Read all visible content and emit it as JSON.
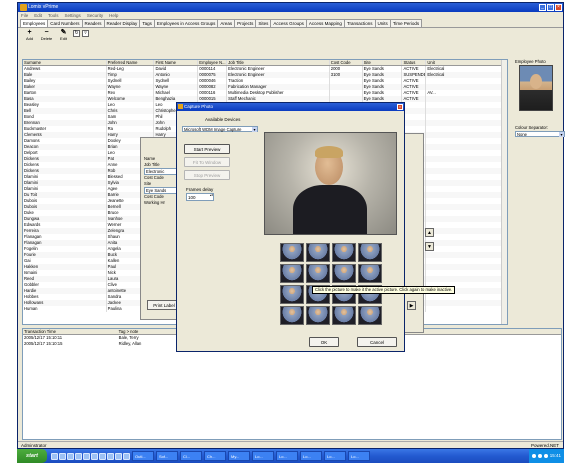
{
  "window": {
    "title": "Lomix vPrime"
  },
  "menu": [
    "File",
    "Edit",
    "Tools",
    "Settings",
    "Security",
    "Help"
  ],
  "tabs": [
    {
      "label": "Employees",
      "active": true
    },
    {
      "label": "Card Numbers"
    },
    {
      "label": "Readers"
    },
    {
      "label": "Reader Display"
    },
    {
      "label": "Tags"
    },
    {
      "label": "Employees in Access Groups"
    },
    {
      "label": "Areas"
    },
    {
      "label": "Projects"
    },
    {
      "label": "Sites"
    },
    {
      "label": "Access Groups"
    },
    {
      "label": "Access Mapping"
    },
    {
      "label": "Transactions"
    },
    {
      "label": "Units"
    },
    {
      "label": "Time Periods"
    }
  ],
  "toolbar": {
    "add": "Add",
    "delete": "Delete",
    "edit": "Edit"
  },
  "employees": {
    "columns": [
      "Surname",
      "Preferred Name",
      "First Name",
      "Employee N...",
      "Job Title",
      "Cost Code",
      "Site",
      "Status",
      "Unit"
    ],
    "rows": [
      [
        "Andrews",
        "Red-Leg",
        "David",
        "0000114",
        "Electronic Engineer",
        "2000",
        "Eye Sands",
        "ACTIVE",
        "Electrical"
      ],
      [
        "Bale",
        "Timp",
        "Antonio",
        "0000075",
        "Electronic Engineer",
        "3100",
        "Eye Sands",
        "SUSPENDED",
        "Electrical"
      ],
      [
        "Bailey",
        "Sydnell",
        "Sydnell",
        "0000046",
        "Traction",
        "",
        "Eye Sands",
        "ACTIVE",
        ""
      ],
      [
        "Baker",
        "Wayne",
        "Wayne",
        "0000082",
        "Fabrication Manager",
        "",
        "Eye Sands",
        "ACTIVE",
        ""
      ],
      [
        "Barton",
        "Rex",
        "Michael",
        "0000116",
        "Multimedia Desktop Publisher",
        "",
        "Eye Sands",
        "ACTIVE",
        "AV..."
      ],
      [
        "Basa",
        "Welcome",
        "Benghazia",
        "0000015",
        "Staff Mechanic",
        "",
        "Eye Sands",
        "ACTIVE",
        ""
      ],
      [
        "Beasley",
        "Leo",
        "Leo",
        "",
        "",
        "",
        "",
        "",
        ""
      ],
      [
        "Bell",
        "Chris",
        "Christopher",
        "",
        "",
        "",
        "",
        "",
        ""
      ],
      [
        "Bond",
        "Sam",
        "Phil",
        "",
        "",
        "",
        "",
        "",
        ""
      ],
      [
        "Brennan",
        "John",
        "John",
        "",
        "",
        "",
        "",
        "",
        ""
      ],
      [
        "Buckmaster",
        "Ra",
        "Rudolph",
        "",
        "",
        "",
        "",
        "",
        ""
      ],
      [
        "Clements",
        "Harry",
        "Harry",
        "",
        "",
        "",
        "",
        "",
        ""
      ],
      [
        "Damons",
        "Dooley",
        "D",
        "",
        "",
        "",
        "",
        "",
        ""
      ],
      [
        "Deacon",
        "Brian",
        "B",
        "",
        "",
        "",
        "",
        "",
        ""
      ],
      [
        "Delport",
        "Leo",
        "L",
        "",
        "",
        "",
        "",
        "",
        ""
      ],
      [
        "Dickens",
        "Pat",
        "P",
        "",
        "",
        "",
        "",
        "",
        ""
      ],
      [
        "Dickens",
        "Anne",
        "A",
        "",
        "",
        "",
        "",
        "",
        ""
      ],
      [
        "Dickens",
        "Rob",
        "R",
        "",
        "",
        "",
        "",
        "",
        ""
      ],
      [
        "Dlamini",
        "Blessed",
        "B",
        "",
        "",
        "",
        "",
        "",
        ""
      ],
      [
        "Dlamini",
        "Sylvia",
        "S",
        "",
        "",
        "",
        "",
        "",
        ""
      ],
      [
        "Dlamini",
        "Agee",
        "A",
        "",
        "",
        "",
        "",
        "",
        ""
      ],
      [
        "Du Toit",
        "Barrie",
        "D",
        "",
        "",
        "",
        "",
        "",
        ""
      ],
      [
        "Dubois",
        "Jeanette",
        "J",
        "",
        "",
        "",
        "",
        "",
        ""
      ],
      [
        "Dubois",
        "Bernell",
        "D",
        "",
        "",
        "",
        "",
        "",
        ""
      ],
      [
        "Duke",
        "Bruce",
        "B",
        "",
        "",
        "",
        "",
        "",
        ""
      ],
      [
        "Dungwa",
        "Ivanhoe",
        "I",
        "",
        "",
        "",
        "",
        "",
        ""
      ],
      [
        "Edwards",
        "Werner",
        "W",
        "",
        "",
        "",
        "",
        "",
        ""
      ],
      [
        "Ferreira",
        "Zelengra",
        "Z",
        "",
        "",
        "",
        "",
        "",
        ""
      ],
      [
        "Flanagan",
        "Shaun",
        "S",
        "",
        "",
        "",
        "",
        "",
        ""
      ],
      [
        "Flanagan",
        "Anita",
        "A",
        "",
        "",
        "",
        "",
        "",
        ""
      ],
      [
        "Fogelin",
        "Angela",
        "A",
        "",
        "",
        "",
        "",
        "",
        ""
      ],
      [
        "Fourie",
        "Buck",
        "B",
        "",
        "",
        "",
        "",
        "",
        ""
      ],
      [
        "Gai",
        "Kallen",
        "C",
        "",
        "",
        "",
        "",
        "",
        ""
      ],
      [
        "Hakken",
        "Paul",
        "P",
        "",
        "",
        "",
        "",
        "",
        ""
      ],
      [
        "Ismaini",
        "Nick",
        "N",
        "",
        "",
        "",
        "",
        "",
        ""
      ],
      [
        "Reed",
        "Laura",
        "L",
        "",
        "",
        "",
        "",
        "",
        ""
      ],
      [
        "Gobbler",
        "Clive",
        "C",
        "",
        "",
        "",
        "",
        "",
        ""
      ],
      [
        "Hardie",
        "antoinette",
        "A",
        "",
        "",
        "",
        "",
        "",
        ""
      ],
      [
        "Hobbes",
        "Sandra",
        "S",
        "",
        "",
        "",
        "",
        "",
        ""
      ],
      [
        "Hollowans",
        "Jackee",
        "J",
        "",
        "",
        "",
        "",
        "",
        ""
      ],
      [
        "Human",
        "Paulina",
        "P",
        "",
        "",
        "",
        "",
        "",
        ""
      ]
    ]
  },
  "photo_panel": {
    "title": "Employee Photo",
    "separator_label": "Colour Separator:",
    "separator_value": "None"
  },
  "transactions": {
    "columns": [
      "Transaction Time",
      "Tag > note",
      "Card"
    ],
    "rows": [
      [
        "2005/12/17 15:10:11",
        "Bale, Terry",
        ""
      ],
      [
        "2005/12/17 15:10:15",
        "Ridley, Allan",
        ""
      ]
    ]
  },
  "status": {
    "left": "Adminstrator",
    "right": "Powered.NET"
  },
  "behind_form": {
    "labels": [
      "Name",
      "Job Title",
      "Electronic",
      "Cost Code",
      "Site",
      "Eye Sands",
      "Cost Code",
      "Working Hr"
    ],
    "print_label": "Print Label"
  },
  "dialog": {
    "title": "Capture Photo",
    "available_devices": "Available Devices",
    "device": "Microsoft WDM Image Capture",
    "start_preview": "Start Preview",
    "fit_to_window": "Fit To Window",
    "stop_preview": "Stop Preview",
    "frames_delay_label": "Frames delay",
    "frames_delay_value": "100",
    "ok": "OK",
    "cancel": "Cancel",
    "tooltip": "Click the picture to make it the active picture. Click again to make inactive."
  },
  "taskbar": {
    "start": "start",
    "tasks": [
      "Outl...",
      "Sof...",
      "Cl...",
      "Ch...",
      "My...",
      "Lo...",
      "Lo...",
      "Lo...",
      "Lo...",
      "Lo..."
    ],
    "clock": "15:41"
  }
}
